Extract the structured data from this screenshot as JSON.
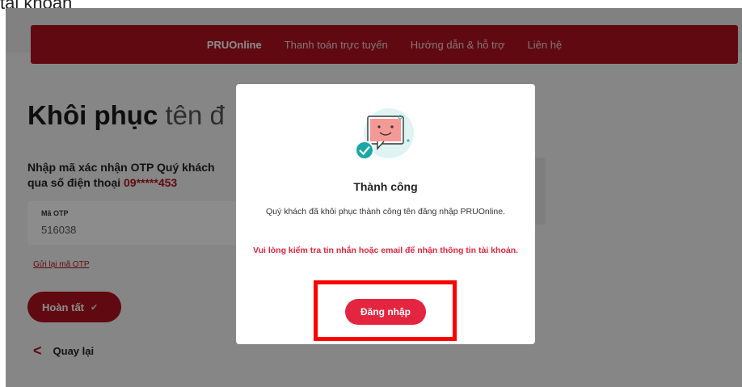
{
  "caption": "tài khoản",
  "nav": {
    "items": [
      "PRUOnline",
      "Thanh toán trực tuyến",
      "Hướng dẫn & hỗ trợ",
      "Liên hệ"
    ]
  },
  "page": {
    "title_bold": "Khôi phục",
    "title_light": "tên đ",
    "otp_line1": "Nhập mã xác nhận OTP Quý khách",
    "otp_line2_prefix": "qua số điện thoại",
    "otp_phone": "09*****453",
    "otp_label": "Mã OTP",
    "otp_value": "516038",
    "resend_link": "Gửi lại mã OTP",
    "done_button": "Hoàn tất",
    "back_link": "Quay lại"
  },
  "modal": {
    "title": "Thành công",
    "message": "Quý khách đã khôi phục thành công tên đăng nhập PRUOnline.",
    "warning": "Vui lòng kiểm tra tin nhắn hoặc email để nhận thông tin tài khoản.",
    "login_button": "Đăng nhập"
  },
  "colors": {
    "brand_red": "#b0111f",
    "alert_red": "#e4253f",
    "highlight_red": "#ff0000",
    "success_teal": "#1aa7a7"
  },
  "icons": {
    "success": "chat-smile-check-icon",
    "done": "checkmark-icon",
    "back": "chevron-left-icon"
  }
}
